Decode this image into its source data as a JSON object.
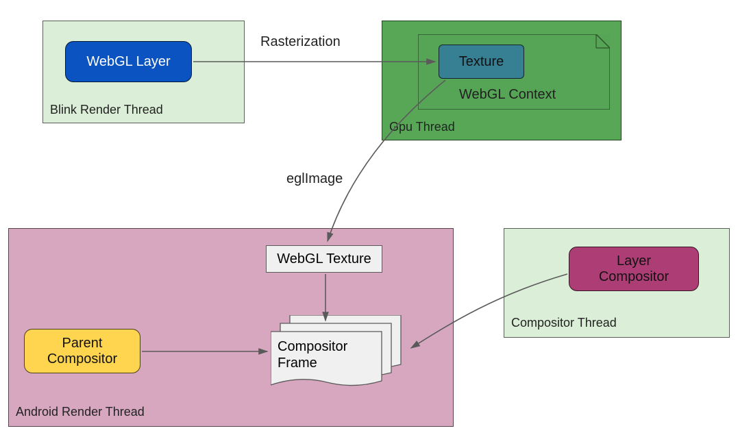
{
  "colors": {
    "blink_bg": "#dbeed7",
    "gpu_bg": "#58a757",
    "android_bg": "#d7a7bf",
    "compositor_bg": "#dbeed7",
    "webgl_layer_bg": "#0a53c0",
    "texture_bg": "#377f93",
    "webgl_context_bg": "#58a757",
    "parent_comp_bg": "#ffd54f",
    "layer_comp_bg": "#ad3e75",
    "node_bg": "#f0f0f0"
  },
  "containers": {
    "blink": {
      "label": "Blink Render Thread"
    },
    "gpu": {
      "label": "Gpu Thread"
    },
    "android": {
      "label": "Android Render Thread"
    },
    "compositor": {
      "label": "Compositor Thread"
    }
  },
  "nodes": {
    "webgl_layer": {
      "label": "WebGL Layer"
    },
    "texture": {
      "label": "Texture"
    },
    "webgl_context": {
      "label": "WebGL Context"
    },
    "webgl_texture": {
      "label": "WebGL Texture"
    },
    "compositor_frame": {
      "label": "Compositor\nFrame"
    },
    "parent_compositor": {
      "label": "Parent\nCompositor"
    },
    "layer_compositor": {
      "label": "Layer\nCompositor"
    }
  },
  "edges": {
    "rasterization": {
      "label": "Rasterization"
    },
    "eglimage": {
      "label": "eglImage"
    }
  }
}
